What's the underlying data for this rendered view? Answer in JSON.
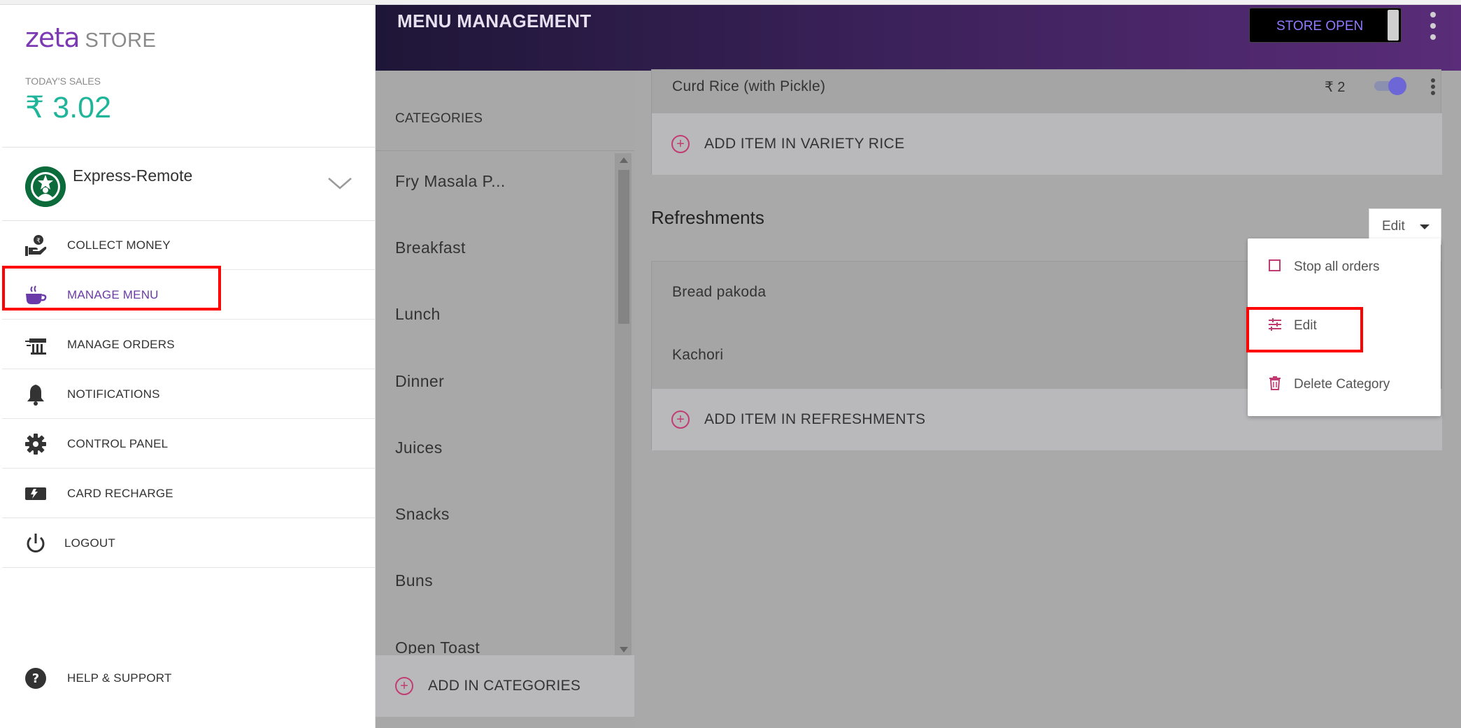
{
  "brand": {
    "logo_word": "zeta",
    "store_word": "STORE"
  },
  "sales": {
    "label": "TODAY'S SALES",
    "value": "₹ 3.02"
  },
  "store": {
    "name": "Express-Remote"
  },
  "nav": {
    "items": [
      {
        "label": "COLLECT MONEY",
        "icon": "collect-money-icon"
      },
      {
        "label": "MANAGE MENU",
        "icon": "coffee-cup-icon"
      },
      {
        "label": "MANAGE ORDERS",
        "icon": "orders-icon"
      },
      {
        "label": "NOTIFICATIONS",
        "icon": "bell-icon"
      },
      {
        "label": "CONTROL PANEL",
        "icon": "gear-icon"
      },
      {
        "label": "CARD RECHARGE",
        "icon": "card-icon"
      },
      {
        "label": "LOGOUT",
        "icon": "power-icon"
      }
    ],
    "help": {
      "label": "HELP & SUPPORT",
      "icon": "help-icon"
    }
  },
  "header": {
    "title": "MENU MANAGEMENT",
    "store_status": "STORE OPEN"
  },
  "categories": {
    "title": "CATEGORIES",
    "items": [
      "Fry Masala P...",
      "Breakfast",
      "Lunch",
      "Dinner",
      "Juices",
      "Snacks",
      "Buns",
      "Open Toast"
    ],
    "add_label": "ADD IN CATEGORIES"
  },
  "variety_rice": {
    "item": {
      "name": "Curd Rice (with Pickle)",
      "price": "₹ 2"
    },
    "add_label": "ADD ITEM IN VARIETY RICE"
  },
  "refreshments": {
    "title": "Refreshments",
    "edit_label": "Edit",
    "items": [
      "Bread pakoda",
      "Kachori"
    ],
    "add_label": "ADD ITEM IN REFRESHMENTS"
  },
  "dropdown": {
    "items": [
      "Stop all orders",
      "Edit",
      "Delete Category"
    ]
  },
  "colors": {
    "accent": "#6a3aa8",
    "sales": "#1fb59a",
    "pink": "#c13c73",
    "highlight": "#ff0000"
  }
}
